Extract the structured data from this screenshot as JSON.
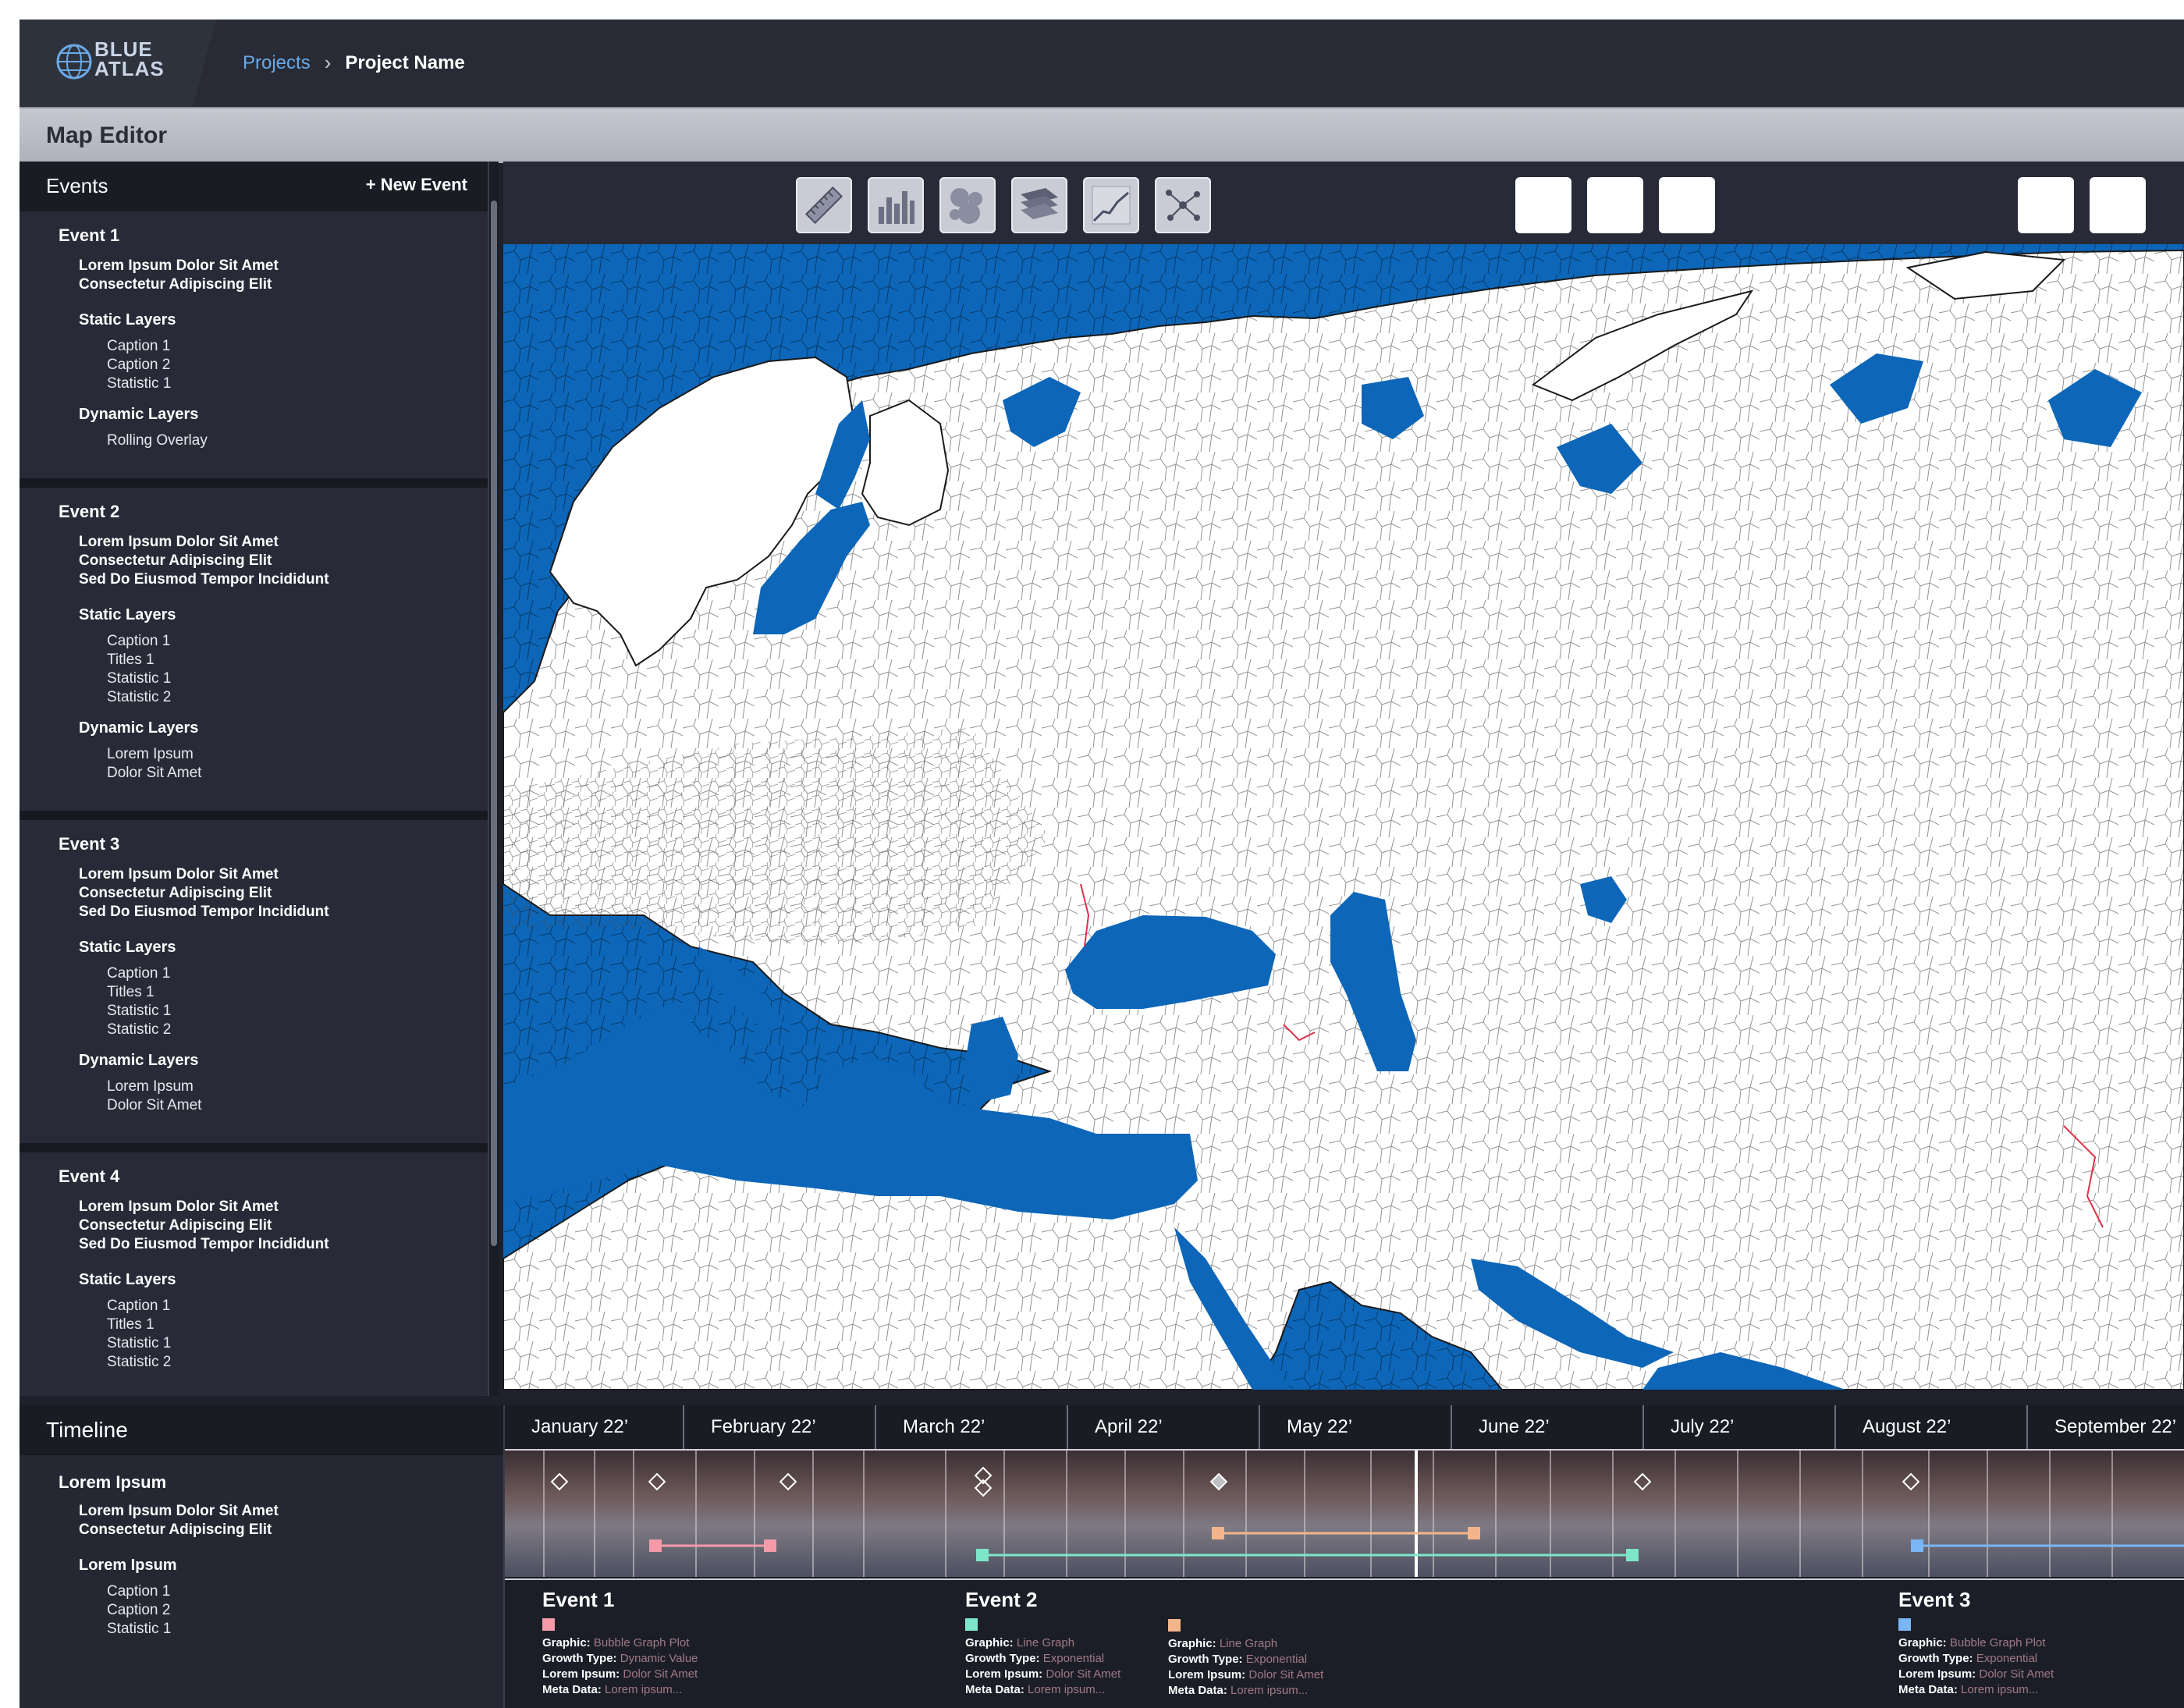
{
  "brand": {
    "line1": "BLUE",
    "line2": "ATLAS"
  },
  "breadcrumb": {
    "link": "Projects",
    "separator": "›",
    "current": "Project Name"
  },
  "subbar": {
    "title": "Map Editor"
  },
  "events_panel": {
    "title": "Events",
    "new_event_label": "+ New Event",
    "events": [
      {
        "title": "Event 1",
        "description": [
          "Lorem Ipsum Dolor Sit Amet",
          "Consectetur Adipiscing Elit"
        ],
        "static_label": "Static Layers",
        "static_items": [
          "Caption 1",
          "Caption 2",
          "Statistic 1"
        ],
        "dynamic_label": "Dynamic Layers",
        "dynamic_items": [
          "Rolling Overlay"
        ]
      },
      {
        "title": "Event 2",
        "description": [
          "Lorem Ipsum Dolor Sit Amet",
          "Consectetur Adipiscing Elit",
          "Sed Do Eiusmod Tempor Incididunt"
        ],
        "static_label": "Static Layers",
        "static_items": [
          "Caption 1",
          "Titles 1",
          "Statistic 1",
          "Statistic 2"
        ],
        "dynamic_label": "Dynamic Layers",
        "dynamic_items": [
          "Lorem Ipsum",
          "Dolor Sit Amet"
        ]
      },
      {
        "title": "Event 3",
        "description": [
          "Lorem Ipsum Dolor Sit Amet",
          "Consectetur Adipiscing Elit",
          "Sed Do Eiusmod Tempor Incididunt"
        ],
        "static_label": "Static Layers",
        "static_items": [
          "Caption 1",
          "Titles 1",
          "Statistic 1",
          "Statistic 2"
        ],
        "dynamic_label": "Dynamic Layers",
        "dynamic_items": [
          "Lorem Ipsum",
          "Dolor Sit Amet"
        ]
      },
      {
        "title": "Event 4",
        "description": [
          "Lorem Ipsum Dolor Sit Amet",
          "Consectetur Adipiscing Elit",
          "Sed Do Eiusmod Tempor Incididunt"
        ],
        "static_label": "Static Layers",
        "static_items": [
          "Caption 1",
          "Titles 1",
          "Statistic 1",
          "Statistic 2"
        ],
        "dynamic_label": "",
        "dynamic_items": []
      }
    ]
  },
  "toolbar": {
    "tools": [
      "ruler-icon",
      "bar-chart-icon",
      "bubble-chart-icon",
      "layers-icon",
      "line-chart-icon",
      "network-icon"
    ],
    "blank_buttons": 5
  },
  "map": {
    "land_color": "#ffffff",
    "water_color": "#0d66b8",
    "border_color": "#1a1a1a"
  },
  "timeline": {
    "title": "Timeline",
    "side": {
      "heading": "Lorem Ipsum",
      "description": [
        "Lorem Ipsum Dolor Sit Amet",
        "Consectetur Adipiscing Elit"
      ],
      "section": "Lorem Ipsum",
      "items": [
        "Caption 1",
        "Caption 2",
        "Statistic 1"
      ]
    },
    "months": [
      "January 22’",
      "February 22’",
      "March 22’",
      "April 22’",
      "May 22’",
      "June 22’",
      "July 22’",
      "August 22’",
      "September 22’"
    ],
    "cards": [
      {
        "title": "Event 1",
        "entries": [
          {
            "color": "#f49aa8",
            "graphic": "Bubble Graph Plot",
            "growth": "Dynamic Value",
            "lorem": "Dolor Sit Amet",
            "meta": "Lorem ipsum..."
          }
        ]
      },
      {
        "title": "Event 2",
        "entries": [
          {
            "color": "#7ee6c8",
            "graphic": "Line Graph",
            "growth": "Exponential",
            "lorem": "Dolor Sit Amet",
            "meta": "Lorem ipsum..."
          },
          {
            "color": "#f4b48a",
            "graphic": "Line Graph",
            "growth": "Exponential",
            "lorem": "Dolor Sit Amet",
            "meta": "Lorem ipsum..."
          }
        ]
      },
      {
        "title": "Event 3",
        "entries": [
          {
            "color": "#7ab6f4",
            "graphic": "Bubble Graph Plot",
            "growth": "Exponential",
            "lorem": "Dolor Sit Amet",
            "meta": "Lorem ipsum..."
          }
        ]
      }
    ],
    "field_labels": {
      "graphic": "Graphic:",
      "growth": "Growth Type:",
      "lorem": "Lorem Ipsum:",
      "meta": "Meta Data:"
    }
  }
}
